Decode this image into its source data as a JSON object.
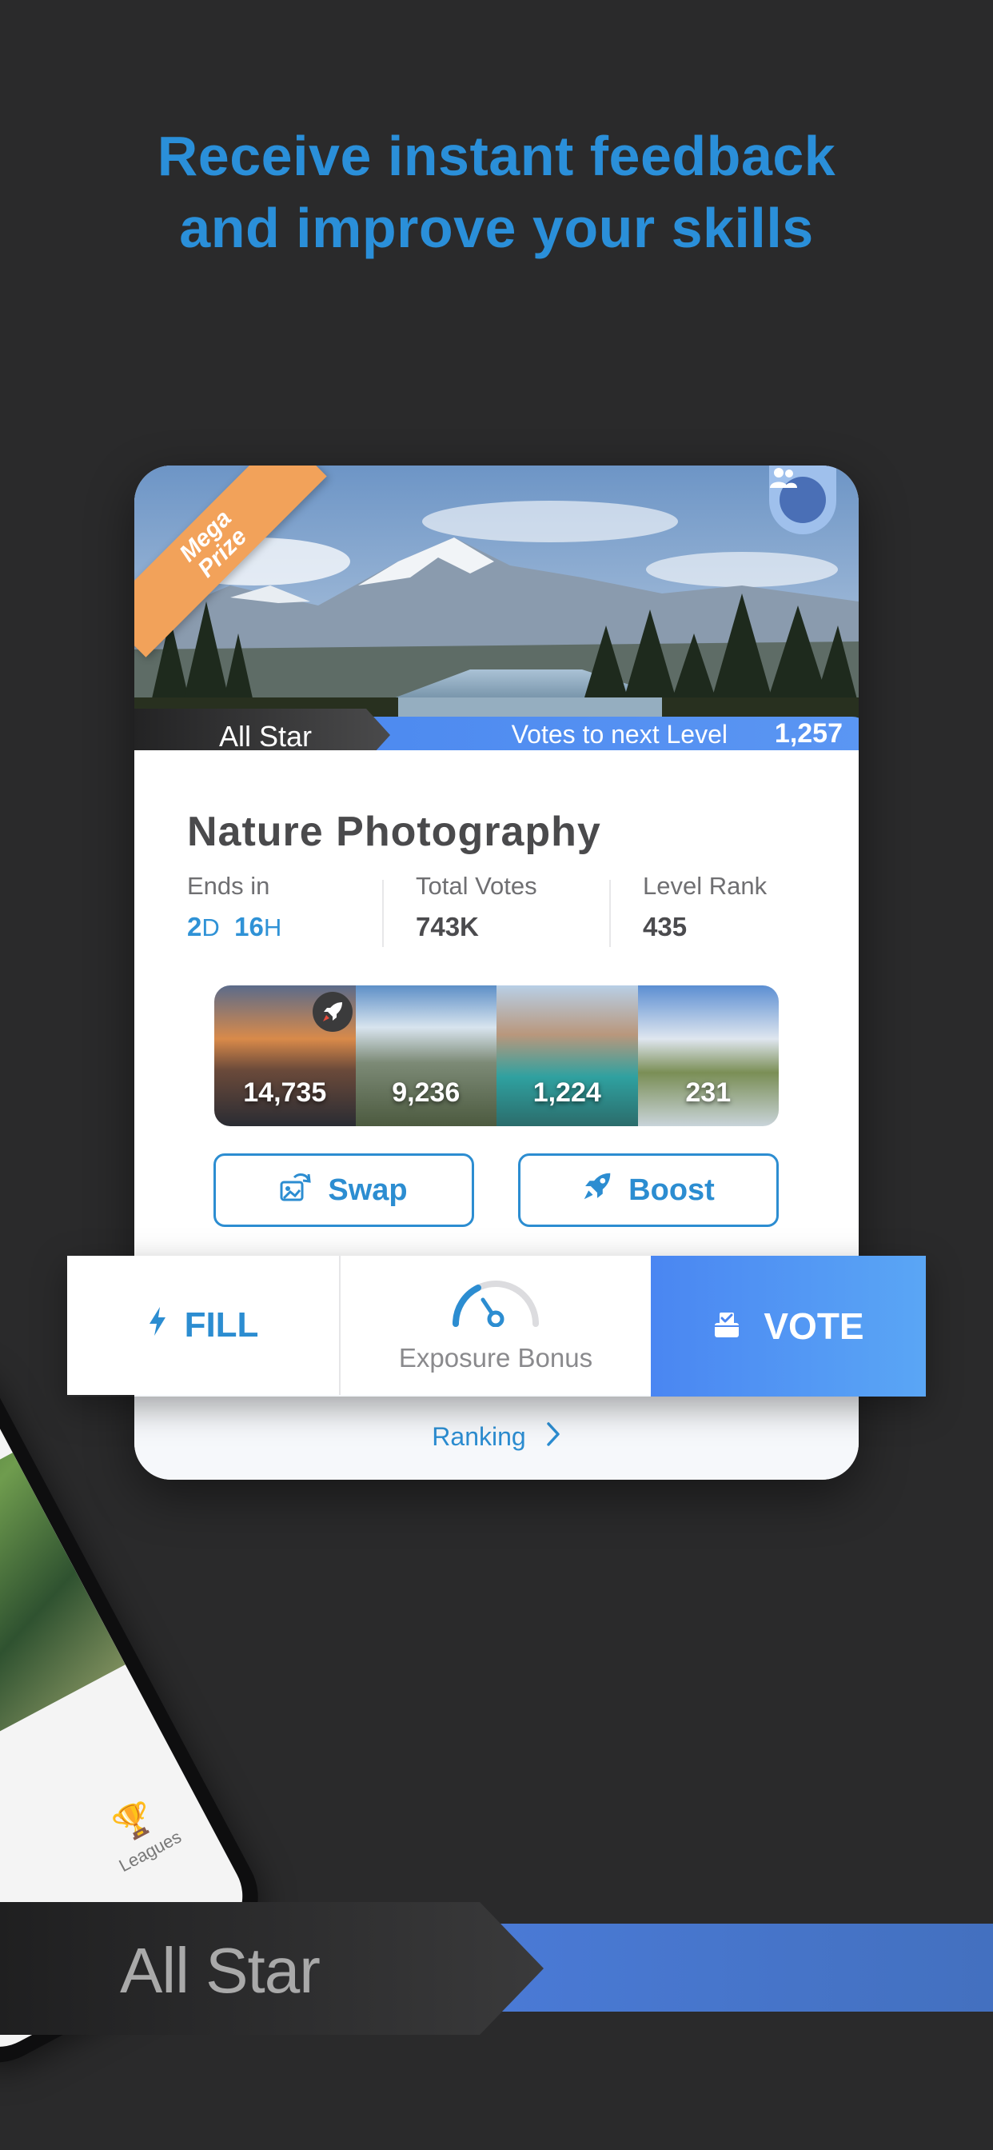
{
  "headline": {
    "line1": "Receive instant feedback",
    "line2": "and improve your skills"
  },
  "card": {
    "badge": {
      "line1": "Mega",
      "line2": "Prize"
    },
    "group_icon": "group-icon",
    "level": {
      "tag": "All Star",
      "votes_label": "Votes to next Level",
      "votes_value": "1,257"
    },
    "title": "Nature Photography",
    "stats": {
      "ends_label": "Ends in",
      "ends_days": "2",
      "ends_days_unit": "D",
      "ends_hours": "16",
      "ends_hours_unit": "H",
      "votes_label": "Total Votes",
      "votes_value": "743K",
      "rank_label": "Level Rank",
      "rank_value": "435"
    },
    "thumbnails": [
      {
        "count": "14,735",
        "boosted": true
      },
      {
        "count": "9,236",
        "boosted": false
      },
      {
        "count": "1,224",
        "boosted": false
      },
      {
        "count": "231",
        "boosted": false
      }
    ],
    "swap_label": "Swap",
    "boost_label": "Boost",
    "ranking_label": "Ranking"
  },
  "vote_bar": {
    "fill_label": "FILL",
    "exposure_label": "Exposure Bonus",
    "vote_label": "VOTE"
  },
  "background_phone": {
    "tab_label": "Leagues"
  },
  "bottom_banner": {
    "tag": "All Star"
  },
  "colors": {
    "background": "#2a2a2b",
    "accent_blue": "#2c8dd1",
    "headline_blue": "#2a8fd9",
    "vote_blue": "#4a86f2",
    "ribbon_orange": "#f2a25a"
  }
}
